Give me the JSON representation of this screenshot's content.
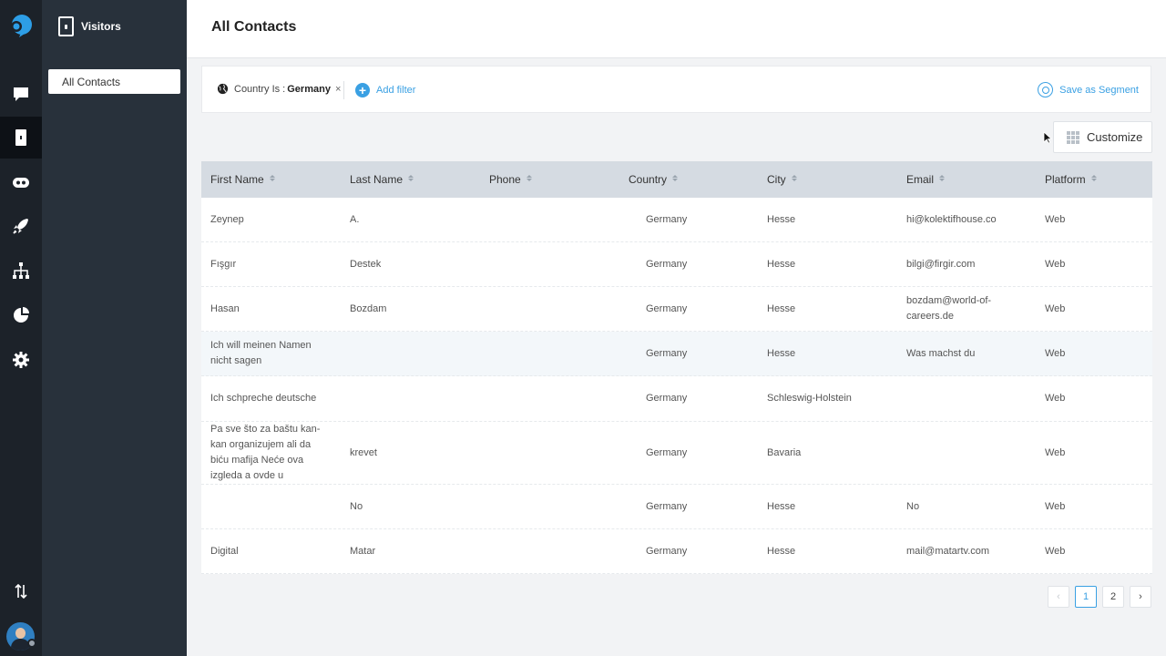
{
  "sidebar": {
    "section_title": "Visitors",
    "items": [
      {
        "label": "All Contacts",
        "active": true
      }
    ]
  },
  "header": {
    "title": "All Contacts"
  },
  "filters": {
    "active": {
      "field_label": "Country Is :",
      "value": "Germany",
      "remove": "×"
    },
    "add_label": "Add filter",
    "save_segment_label": "Save as Segment"
  },
  "toolbar": {
    "customize_label": "Customize"
  },
  "table": {
    "columns": [
      "First Name",
      "Last Name",
      "Phone",
      "Country",
      "City",
      "Email",
      "Platform"
    ],
    "rows": [
      [
        "Zeynep",
        "A.",
        "",
        "Germany",
        "Hesse",
        "hi@kolektifhouse.co",
        "Web"
      ],
      [
        "Fışgır",
        "Destek",
        "",
        "Germany",
        "Hesse",
        "bilgi@firgir.com",
        "Web"
      ],
      [
        "Hasan",
        "Bozdam",
        "",
        "Germany",
        "Hesse",
        "bozdam@world-of-careers.de",
        "Web"
      ],
      [
        "Ich will meinen Namen nicht sagen",
        "",
        "",
        "Germany",
        "Hesse",
        "Was machst du",
        "Web"
      ],
      [
        "Ich schpreche deutsche",
        "",
        "",
        "Germany",
        "Schleswig-Holstein",
        "",
        "Web"
      ],
      [
        "Pa sve što za baštu kan-kan organizujem ali da biću mafija Neće ova izgleda a ovde u",
        "krevet",
        "",
        "Germany",
        "Bavaria",
        "",
        "Web"
      ],
      [
        "",
        "No",
        "",
        "Germany",
        "Hesse",
        "No",
        "Web"
      ],
      [
        "Digital",
        "Matar",
        "",
        "Germany",
        "Hesse",
        "mail@matartv.com",
        "Web"
      ]
    ]
  },
  "pagination": {
    "prev": "‹",
    "pages": [
      "1",
      "2"
    ],
    "current": "1",
    "next": "›"
  },
  "colors": {
    "accent": "#3aa0e3",
    "rail": "#1c2229",
    "sidebar": "#28313b",
    "header_row": "#d5dbe2"
  }
}
